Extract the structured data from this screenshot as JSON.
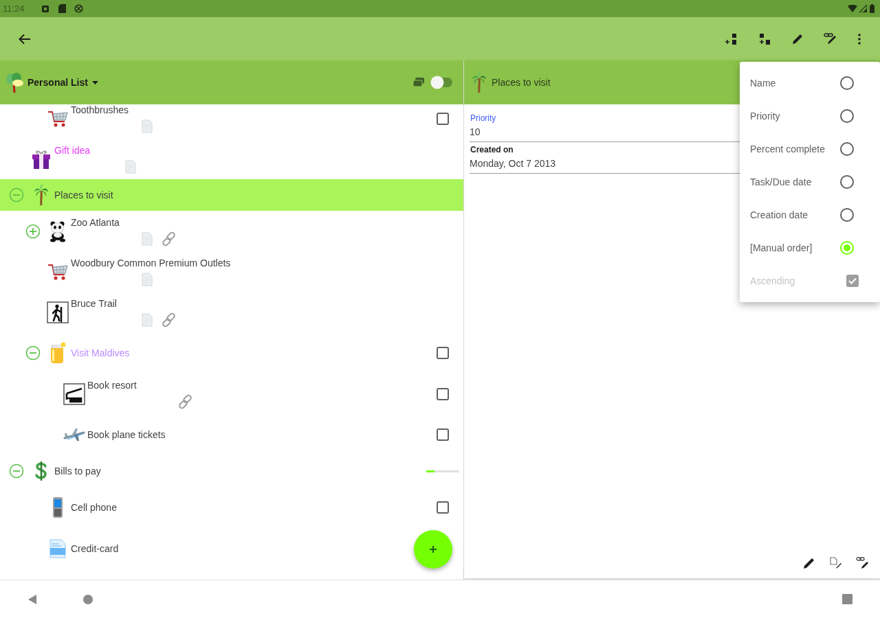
{
  "status_bar": {
    "time": "11:24"
  },
  "list_header": {
    "title": "Personal List",
    "switch": {
      "on": false
    }
  },
  "tree": [
    {
      "children": [
        {
          "label": "Toothbrushes",
          "color": "#424242",
          "selected": false,
          "note": true,
          "link": false,
          "checked": false
        }
      ]
    },
    {
      "label": "Gift idea",
      "color": "#e53cf5",
      "selected": false,
      "note": true,
      "link": false
    },
    {
      "label": "Places to visit",
      "color": "#424242",
      "selected": true,
      "expanded": true,
      "note": false,
      "link": false,
      "children": [
        {
          "label": "Zoo Atlanta",
          "color": "#424242",
          "selected": false,
          "expanded": false,
          "note": true,
          "link": true
        },
        {
          "label": "Woodbury Common Premium Outlets",
          "color": "#424242",
          "selected": false,
          "note": true,
          "link": false
        },
        {
          "label": "Bruce Trail",
          "color": "#424242",
          "selected": false,
          "note": true,
          "link": true
        },
        {
          "label": "Visit Maldives",
          "color": "#b98cff",
          "selected": false,
          "expanded": true,
          "note": false,
          "link": false,
          "checked": false,
          "children": [
            {
              "label": "Book resort",
              "color": "#424242",
              "selected": false,
              "note": false,
              "link": true,
              "checked": false
            },
            {
              "label": "Book plane tickets",
              "color": "#424242",
              "selected": false,
              "note": false,
              "link": false,
              "checked": false
            }
          ]
        }
      ]
    },
    {
      "label": "Bills to pay",
      "color": "#424242",
      "selected": false,
      "expanded": true,
      "note": false,
      "link": false,
      "level": 0.25,
      "children": [
        {
          "label": "Cell phone",
          "color": "#424242",
          "selected": false,
          "note": false,
          "link": false,
          "checked": false
        },
        {
          "label": "Credit-card",
          "color": "#424242",
          "selected": false,
          "note": false,
          "link": false
        }
      ]
    }
  ],
  "detail": {
    "title": "Places to visit",
    "fields": [
      {
        "label": "Priority",
        "value": "10",
        "focused": true
      },
      {
        "label": "Created on",
        "value": "Monday, Oct 7 2013",
        "focused": false
      }
    ]
  },
  "sort_menu": {
    "options": [
      {
        "label": "Name",
        "selected": false
      },
      {
        "label": "Priority",
        "selected": false
      },
      {
        "label": "Percent complete",
        "selected": false
      },
      {
        "label": "Task/Due date",
        "selected": false
      },
      {
        "label": "Creation date",
        "selected": false
      },
      {
        "label": "[Manual order]",
        "selected": true
      }
    ],
    "ascending": {
      "label": "Ascending",
      "checked": true,
      "disabled": true
    }
  }
}
